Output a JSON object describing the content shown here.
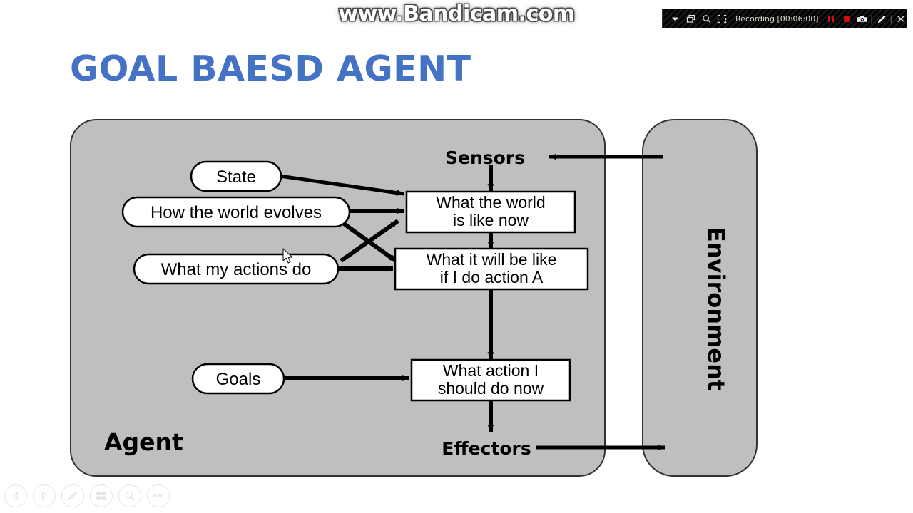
{
  "watermark": {
    "text": "www.Bandicam.com"
  },
  "recorder": {
    "label": "Recording [00:06:00]",
    "icons": [
      "chevron-down-icon",
      "window-restore-icon",
      "magnifier-icon",
      "crop-region-icon"
    ],
    "controls": [
      "pause-icon",
      "record-stop-icon",
      "camera-icon",
      "pen-icon",
      "close-icon"
    ],
    "accent_red": "#cc1111",
    "bar_background": "#000000"
  },
  "slide": {
    "title": "GOAL BAESD AGENT",
    "title_color": "#4472C4",
    "background": "#ffffff"
  },
  "diagram": {
    "fill_gray": "#bfbfbf",
    "stroke": "#000000",
    "node_fill": "#ffffff",
    "agent_label": "Agent",
    "environment_label": "Environment",
    "sensors_label": "Sensors",
    "effectors_label": "Effectors",
    "pills": [
      {
        "id": "state",
        "label": "State"
      },
      {
        "id": "how-the-world-evolves",
        "label": "How the world evolves"
      },
      {
        "id": "what-my-actions-do",
        "label": "What my actions do"
      },
      {
        "id": "goals",
        "label": "Goals"
      }
    ],
    "boxes": [
      {
        "id": "what-the-world-is-like-now",
        "line1": "What the world",
        "line2": "is like now"
      },
      {
        "id": "what-it-will-be-like-if-i-do-action-a",
        "line1": "What it will be like",
        "line2": "if I do action A"
      },
      {
        "id": "what-action-i-should-do-now",
        "line1": "What action I",
        "line2": "should do now"
      }
    ]
  },
  "presenter_toolbar": {
    "buttons": [
      "previous-slide-icon",
      "next-slide-icon",
      "pen-tool-icon",
      "slide-grid-icon",
      "zoom-icon",
      "more-options-icon"
    ]
  }
}
